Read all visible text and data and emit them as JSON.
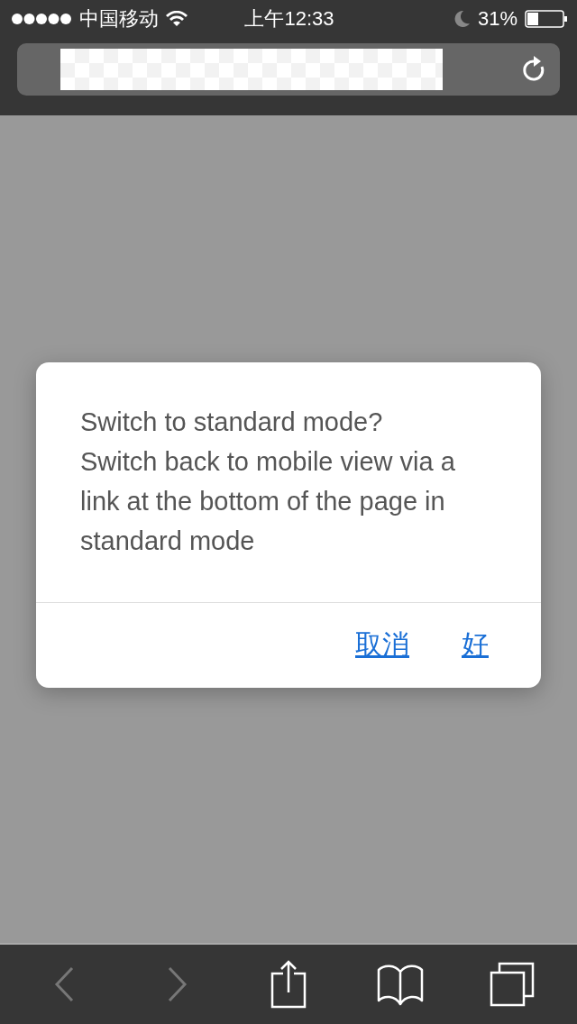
{
  "status_bar": {
    "carrier": "中国移动",
    "time": "上午12:33",
    "battery": "31%"
  },
  "dialog": {
    "message": "Switch to standard mode?\nSwitch back to mobile view via a link at the bottom of the page in standard mode",
    "buttons": [
      "取消",
      "好"
    ]
  },
  "toolbar": {
    "back_disabled": true,
    "forward_disabled": true
  }
}
